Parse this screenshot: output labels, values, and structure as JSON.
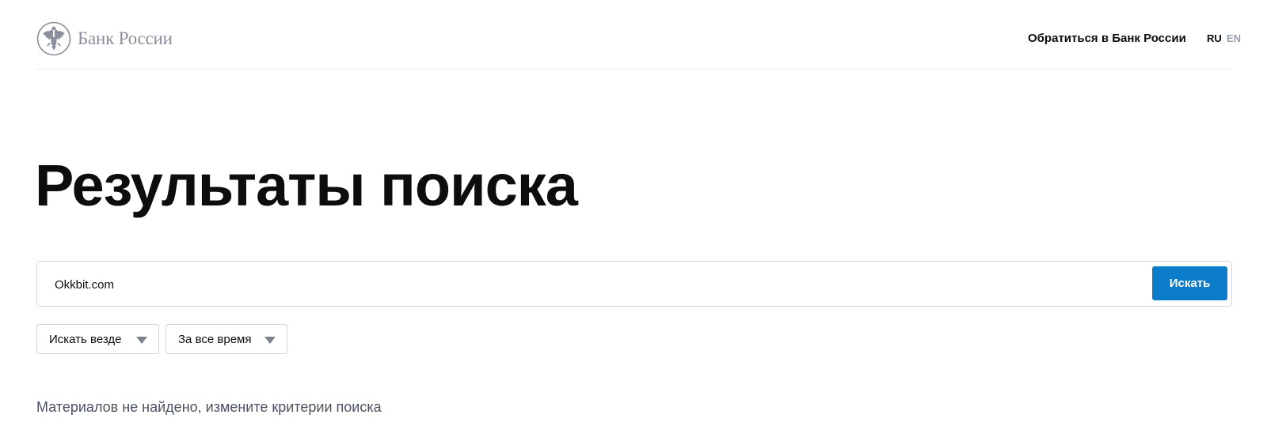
{
  "header": {
    "logo_text": "Банк России",
    "contact_link": "Обратиться в Банк России",
    "languages": [
      {
        "code": "RU",
        "active": true
      },
      {
        "code": "EN",
        "active": false
      }
    ]
  },
  "main": {
    "title": "Результаты поиска",
    "search": {
      "value": "Okkbit.com",
      "button_label": "Искать"
    },
    "filters": [
      {
        "label": "Искать везде"
      },
      {
        "label": "За все время"
      }
    ],
    "no_results_message": "Материалов не найдено, измените критерии поиска"
  },
  "colors": {
    "accent": "#0a7cc9",
    "logo_gray": "#8a8f9c",
    "inactive_lang": "#9aa0ac",
    "border": "#cfd3da"
  },
  "icons": {
    "emblem": "double-headed-eagle-emblem-icon",
    "filter_dropdown": "chevron-down-icon"
  }
}
